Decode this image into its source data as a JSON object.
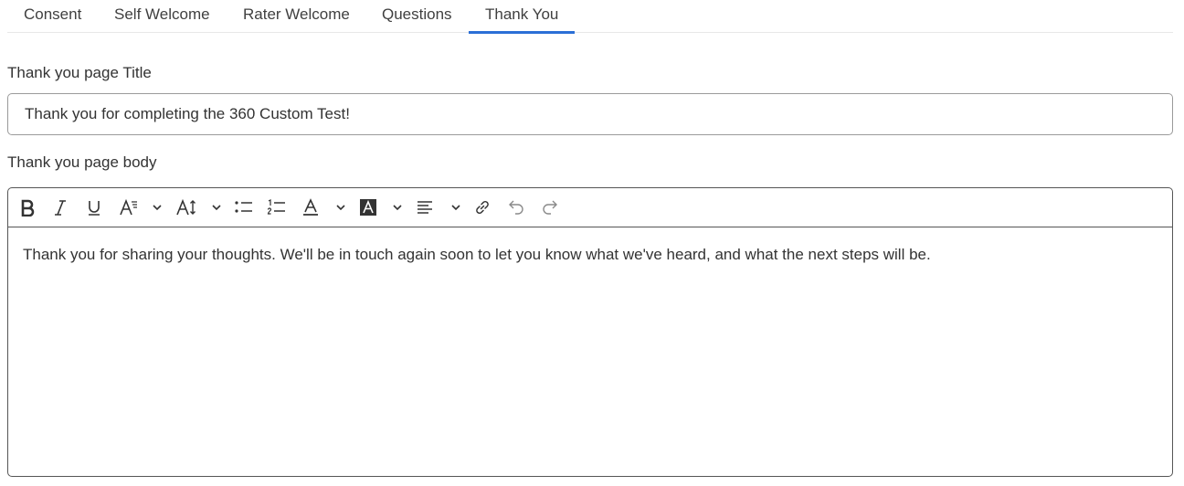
{
  "tabs": [
    {
      "label": "Consent",
      "active": false
    },
    {
      "label": "Self Welcome",
      "active": false
    },
    {
      "label": "Rater Welcome",
      "active": false
    },
    {
      "label": "Questions",
      "active": false
    },
    {
      "label": "Thank You",
      "active": true
    }
  ],
  "form": {
    "title_label": "Thank you page Title",
    "title_value": "Thank you for completing the 360 Custom Test!",
    "body_label": "Thank you page body",
    "body_text": "Thank you for sharing your thoughts. We'll be in touch again soon to let you know what we've heard, and what the next steps will be."
  },
  "toolbar": {
    "icons": [
      "bold-icon",
      "italic-icon",
      "underline-icon",
      "font-family-icon",
      "chevron-down-icon",
      "font-size-icon",
      "chevron-down-icon",
      "bulleted-list-icon",
      "numbered-list-icon",
      "font-color-icon",
      "chevron-down-icon",
      "highlight-color-icon",
      "chevron-down-icon",
      "align-left-icon",
      "chevron-down-icon",
      "link-icon",
      "undo-icon",
      "redo-icon"
    ]
  },
  "colors": {
    "accent": "#2b6fd6",
    "text": "#333333",
    "border": "#9a9a9a"
  }
}
